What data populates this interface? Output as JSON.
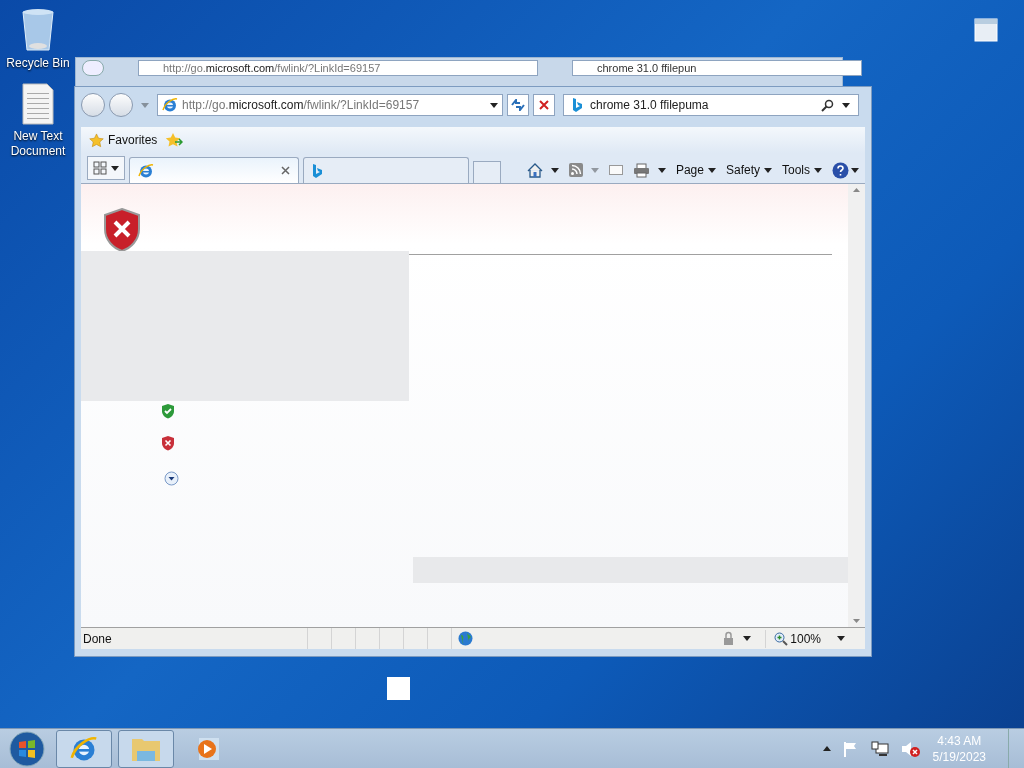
{
  "desktop_icons": [
    {
      "kind": "recycle",
      "label": "Recycle Bin"
    },
    {
      "kind": "text",
      "label": "New Text Document"
    }
  ],
  "back_window": {
    "address": {
      "prefix": "http://go.",
      "domain": "microsoft.com",
      "path": "/fwlink/?LinkId=69157"
    },
    "search": "chrome 31.0 ffilepun"
  },
  "browser": {
    "address": {
      "prefix": "http://go.",
      "domain": "microsoft.com",
      "path": "/fwlink/?LinkId=69157"
    },
    "search": "chrome 31.0 ffilepuma",
    "favorites": "Favorites",
    "tabs": [
      {
        "kind": "ie",
        "selected": true
      },
      {
        "kind": "bing",
        "selected": false
      }
    ],
    "menus": [
      {
        "label": "Page"
      },
      {
        "label": "Safety"
      },
      {
        "label": "Tools"
      }
    ],
    "status": "Done",
    "zoom": "100%"
  },
  "taskbar": {
    "items": [
      {
        "kind": "ie",
        "running": true
      },
      {
        "kind": "explorer",
        "running": true
      },
      {
        "kind": "media",
        "running": false
      }
    ],
    "time": "4:43 AM",
    "date": "5/19/2023"
  }
}
